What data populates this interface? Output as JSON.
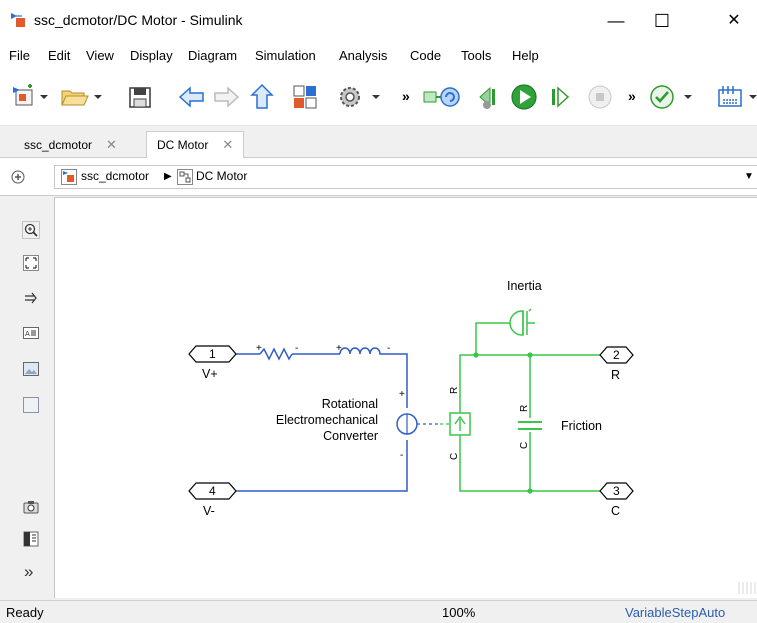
{
  "window": {
    "title": "ssc_dcmotor/DC Motor - Simulink",
    "minimize_glyph": "—",
    "maximize_glyph": "☐",
    "close_glyph": "✕"
  },
  "menu": {
    "items": [
      "File",
      "Edit",
      "View",
      "Display",
      "Diagram",
      "Simulation",
      "Analysis",
      "Code",
      "Tools",
      "Help"
    ]
  },
  "toolbar": {
    "overflow_glyph": "»",
    "icons": [
      "new-model-icon",
      "open-icon",
      "save-icon",
      "back-icon",
      "forward-icon",
      "up-icon",
      "library-browser-icon",
      "model-settings-icon",
      "step-back-icon",
      "run-icon",
      "step-forward-icon",
      "stop-icon",
      "check-icon",
      "config-icon"
    ]
  },
  "tabs": [
    {
      "label": "ssc_dcmotor",
      "close": "✕"
    },
    {
      "label": "DC Motor",
      "close": "✕"
    }
  ],
  "breadcrumb": {
    "root": "ssc_dcmotor",
    "separator": "▶",
    "current": "DC Motor",
    "dropdown": "▼"
  },
  "palette": {
    "collapse_glyph": "»"
  },
  "diagram": {
    "ports": [
      {
        "num": "1",
        "label": "V+"
      },
      {
        "num": "4",
        "label": "V-"
      },
      {
        "num": "2",
        "label": "R"
      },
      {
        "num": "3",
        "label": "C"
      }
    ],
    "converter_label": [
      "Rotational",
      "Electromechanical",
      "Converter"
    ],
    "plus_sign": "+",
    "minus_sign": "-",
    "resistor_plus": "+",
    "resistor_minus": "-",
    "inductor_plus": "+",
    "inductor_minus": "-",
    "inertia_label": "Inertia",
    "friction_label": "Friction",
    "rot_port_r": "R",
    "rot_port_c": "C",
    "fric_port_r": "R",
    "fric_port_c": "C",
    "colors": {
      "electrical": "#2e5ec7",
      "mechanical": "#39c64a"
    }
  },
  "status": {
    "left": "Ready",
    "zoom": "100%",
    "solver": "VariableStepAuto"
  }
}
